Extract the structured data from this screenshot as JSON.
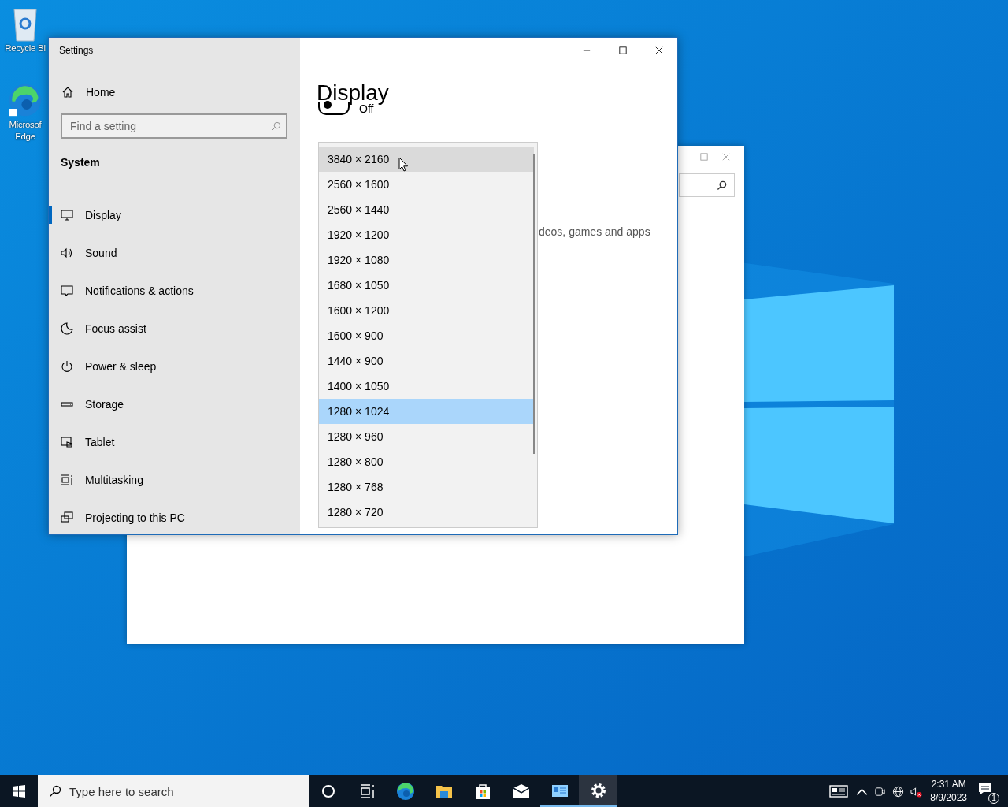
{
  "desktop_icons": [
    {
      "kind": "recycle",
      "label": "Recycle Bi"
    },
    {
      "kind": "edge",
      "label": "Microsof Edge"
    }
  ],
  "settings": {
    "title": "Settings",
    "home": "Home",
    "search": {
      "placeholder": "Find a setting"
    },
    "section": "System",
    "nav": [
      {
        "kind": "display",
        "label": "Display",
        "selected": true
      },
      {
        "kind": "sound",
        "label": "Sound",
        "selected": false
      },
      {
        "kind": "notifications",
        "label": "Notifications & actions",
        "selected": false
      },
      {
        "kind": "focus",
        "label": "Focus assist",
        "selected": false
      },
      {
        "kind": "power",
        "label": "Power & sleep",
        "selected": false
      },
      {
        "kind": "storage",
        "label": "Storage",
        "selected": false
      },
      {
        "kind": "tablet",
        "label": "Tablet",
        "selected": false
      },
      {
        "kind": "multitasking",
        "label": "Multitasking",
        "selected": false
      },
      {
        "kind": "projecting",
        "label": "Projecting to this PC",
        "selected": false
      }
    ],
    "heading": "Display",
    "toggle": {
      "on": false,
      "label": "Off"
    },
    "partial_text": "deos, games and apps",
    "dropdown": [
      {
        "label": "3840 × 2160",
        "hovered": true,
        "selected": false
      },
      {
        "label": "2560 × 1600",
        "hovered": false,
        "selected": false
      },
      {
        "label": "2560 × 1440",
        "hovered": false,
        "selected": false
      },
      {
        "label": "1920 × 1200",
        "hovered": false,
        "selected": false
      },
      {
        "label": "1920 × 1080",
        "hovered": false,
        "selected": false
      },
      {
        "label": "1680 × 1050",
        "hovered": false,
        "selected": false
      },
      {
        "label": "1600 × 1200",
        "hovered": false,
        "selected": false
      },
      {
        "label": "1600 × 900",
        "hovered": false,
        "selected": false
      },
      {
        "label": "1440 × 900",
        "hovered": false,
        "selected": false
      },
      {
        "label": "1400 × 1050",
        "hovered": false,
        "selected": false
      },
      {
        "label": "1280 × 1024",
        "hovered": false,
        "selected": true
      },
      {
        "label": "1280 × 960",
        "hovered": false,
        "selected": false
      },
      {
        "label": "1280 × 800",
        "hovered": false,
        "selected": false
      },
      {
        "label": "1280 × 768",
        "hovered": false,
        "selected": false
      },
      {
        "label": "1280 × 720",
        "hovered": false,
        "selected": false
      }
    ]
  },
  "taskbar": {
    "search": {
      "placeholder": "Type here to search"
    },
    "apps": [
      {
        "kind": "cortana",
        "running": false,
        "selected": false
      },
      {
        "kind": "taskview",
        "running": false,
        "selected": false
      },
      {
        "kind": "edge",
        "running": false,
        "selected": false
      },
      {
        "kind": "explorer",
        "running": false,
        "selected": false
      },
      {
        "kind": "store",
        "running": false,
        "selected": false
      },
      {
        "kind": "mail",
        "running": false,
        "selected": false
      },
      {
        "kind": "app",
        "running": true,
        "selected": false
      },
      {
        "kind": "settings",
        "running": true,
        "selected": true
      }
    ],
    "time": "2:31 AM",
    "date": "8/9/2023",
    "notifications": "1"
  }
}
